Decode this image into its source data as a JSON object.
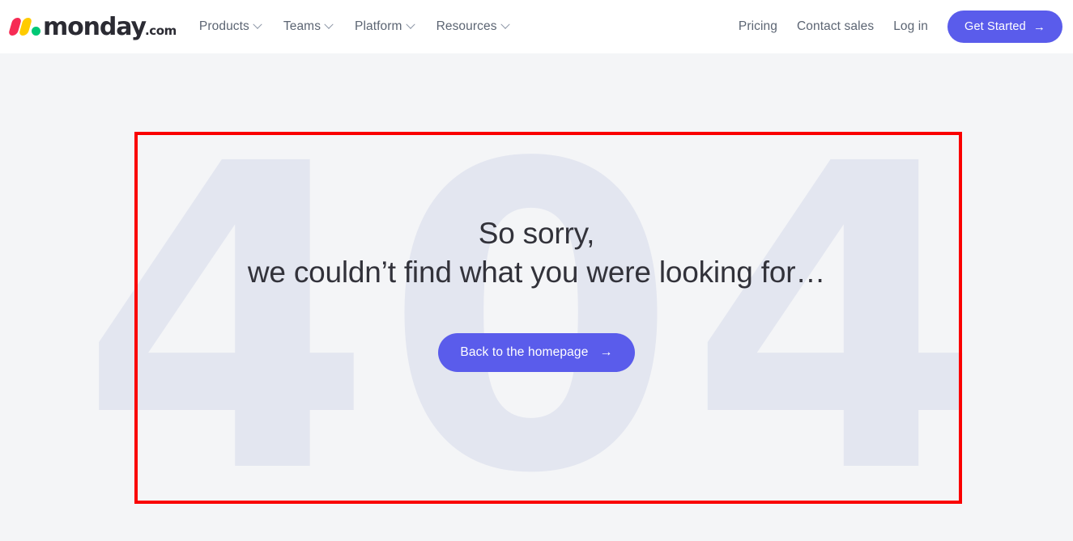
{
  "header": {
    "brand": {
      "name": "monday",
      "tld": ".com",
      "logo_colors": {
        "red": "#f62b54",
        "yellow": "#ffcb00",
        "green": "#00c875"
      }
    },
    "nav_left": [
      {
        "label": "Products",
        "icon": "chevron-down-icon"
      },
      {
        "label": "Teams",
        "icon": "chevron-down-icon"
      },
      {
        "label": "Platform",
        "icon": "chevron-down-icon"
      },
      {
        "label": "Resources",
        "icon": "chevron-down-icon"
      }
    ],
    "nav_right": [
      {
        "label": "Pricing"
      },
      {
        "label": "Contact sales"
      },
      {
        "label": "Log in"
      }
    ],
    "cta": {
      "label": "Get Started",
      "icon": "arrow-right-icon",
      "arrow": "→",
      "color": "#5a5ceb"
    },
    "background": "#ffffff"
  },
  "main": {
    "watermark": "404",
    "watermark_color": "#e3e6f0",
    "title_line1": "So sorry,",
    "title_line2": "we couldn’t find what you were looking for…",
    "title_color": "#32323a",
    "cta": {
      "label": "Back to the homepage",
      "icon": "arrow-right-icon",
      "arrow": "→",
      "color": "#5a5ceb"
    },
    "background": "#f4f5f7"
  },
  "annotation": {
    "highlight_color": "#fa0000",
    "shape": "rectangle"
  }
}
